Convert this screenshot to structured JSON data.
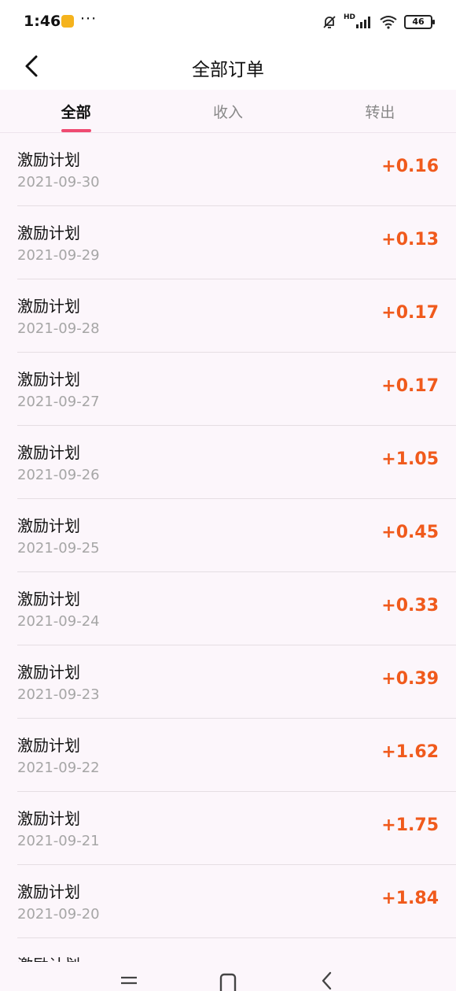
{
  "status": {
    "time": "1:46",
    "more": "···",
    "battery": "46",
    "network_label": "HD"
  },
  "header": {
    "title": "全部订单"
  },
  "tabs": [
    {
      "label": "全部",
      "active": true
    },
    {
      "label": "收入",
      "active": false
    },
    {
      "label": "转出",
      "active": false
    }
  ],
  "orders": [
    {
      "title": "激励计划",
      "date": "2021-09-30",
      "amount": "+0.16"
    },
    {
      "title": "激励计划",
      "date": "2021-09-29",
      "amount": "+0.13"
    },
    {
      "title": "激励计划",
      "date": "2021-09-28",
      "amount": "+0.17"
    },
    {
      "title": "激励计划",
      "date": "2021-09-27",
      "amount": "+0.17"
    },
    {
      "title": "激励计划",
      "date": "2021-09-26",
      "amount": "+1.05"
    },
    {
      "title": "激励计划",
      "date": "2021-09-25",
      "amount": "+0.45"
    },
    {
      "title": "激励计划",
      "date": "2021-09-24",
      "amount": "+0.33"
    },
    {
      "title": "激励计划",
      "date": "2021-09-23",
      "amount": "+0.39"
    },
    {
      "title": "激励计划",
      "date": "2021-09-22",
      "amount": "+1.62"
    },
    {
      "title": "激励计划",
      "date": "2021-09-21",
      "amount": "+1.75"
    },
    {
      "title": "激励计划",
      "date": "2021-09-20",
      "amount": "+1.84"
    },
    {
      "title": "激励计划",
      "date": "",
      "amount": ""
    }
  ],
  "colors": {
    "accent": "#ef4a71",
    "amount": "#f05a1c",
    "list_bg": "#fcf6fb"
  }
}
